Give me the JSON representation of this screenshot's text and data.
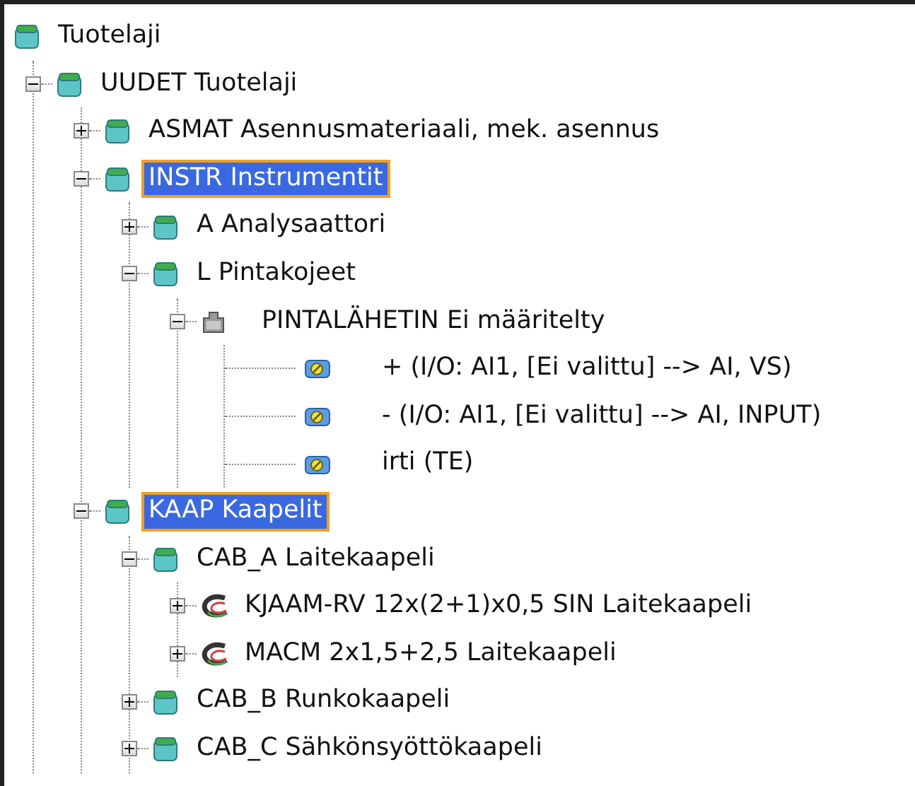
{
  "tree": {
    "label": "Tuotelaji",
    "kind": "category",
    "selected": false,
    "children": [
      {
        "label": "UUDET Tuotelaji",
        "kind": "category",
        "selected": false,
        "expanded": true,
        "children": [
          {
            "label": "ASMAT Asennusmateriaali, mek. asennus",
            "kind": "category",
            "selected": false,
            "expanded": false
          },
          {
            "label": "INSTR Instrumentit",
            "kind": "category",
            "selected": true,
            "expanded": true,
            "children": [
              {
                "label": "A Analysaattori",
                "kind": "category",
                "selected": false,
                "expanded": false
              },
              {
                "label": "L Pintakojeet",
                "kind": "category",
                "selected": false,
                "expanded": true,
                "children": [
                  {
                    "label": "PINTALÄHETIN Ei määritelty",
                    "kind": "device",
                    "selected": false,
                    "expanded": true,
                    "children": [
                      {
                        "label": "+  (I/O: AI1, [Ei valittu] --> AI, VS)",
                        "kind": "terminal",
                        "selected": false
                      },
                      {
                        "label": "-  (I/O: AI1, [Ei valittu] --> AI, INPUT)",
                        "kind": "terminal",
                        "selected": false
                      },
                      {
                        "label": "irti  (TE)",
                        "kind": "terminal",
                        "selected": false
                      }
                    ]
                  }
                ]
              }
            ]
          },
          {
            "label": "KAAP Kaapelit",
            "kind": "category",
            "selected": true,
            "expanded": true,
            "children": [
              {
                "label": "CAB_A Laitekaapeli",
                "kind": "category",
                "selected": false,
                "expanded": true,
                "children": [
                  {
                    "label": "KJAAM-RV 12x(2+1)x0,5 SIN Laitekaapeli",
                    "kind": "cable",
                    "selected": false,
                    "expanded": false
                  },
                  {
                    "label": "MACM 2x1,5+2,5  Laitekaapeli",
                    "kind": "cable",
                    "selected": false,
                    "expanded": false
                  }
                ]
              },
              {
                "label": "CAB_B Runkokaapeli",
                "kind": "category",
                "selected": false,
                "expanded": false
              },
              {
                "label": "CAB_C Sähkönsyöttökaapeli",
                "kind": "category",
                "selected": false,
                "expanded": false
              }
            ]
          }
        ]
      }
    ]
  }
}
